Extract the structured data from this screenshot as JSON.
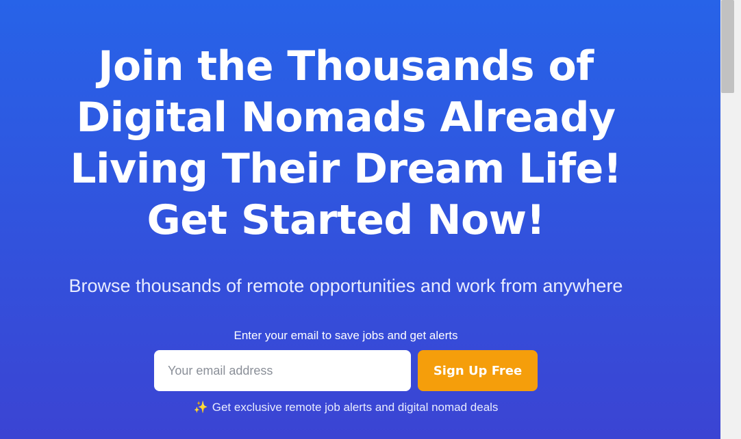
{
  "hero": {
    "headline_line1": "Join the Thousands of",
    "headline_line2": "Digital Nomads Already",
    "headline_line3": "Living Their Dream Life!",
    "headline_line4": "Get Started Now!",
    "subtitle": "Browse thousands of remote opportunities and work from anywhere"
  },
  "signup": {
    "prompt": "Enter your email to save jobs and get alerts",
    "email_placeholder": "Your email address",
    "email_value": "",
    "button_label": "Sign Up Free",
    "perks_icon": "✨",
    "perks_text": "Get exclusive remote job alerts and digital nomad deals"
  },
  "colors": {
    "gradient_top": "#2763e8",
    "gradient_bottom": "#3b44d3",
    "button": "#f59e0b",
    "text": "#ffffff"
  },
  "icons": {
    "perks": "sparkles-icon"
  }
}
